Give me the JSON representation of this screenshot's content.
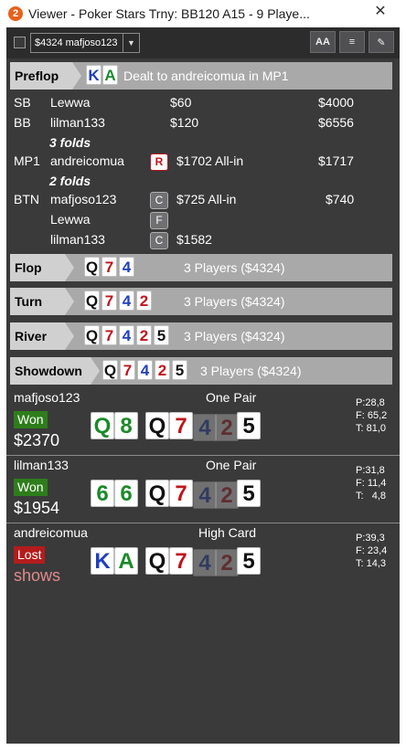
{
  "window": {
    "app_icon_glyph": "2",
    "title": "Viewer - Poker Stars Trny: BB120 A15 - 9 Playe..."
  },
  "toolbar": {
    "hand_select_value": "$4324 mafjoso123",
    "buttons": [
      "AA",
      "≡",
      "✎"
    ]
  },
  "preflop": {
    "label": "Preflop",
    "hero_cards": [
      {
        "rank": "K",
        "suit": "d"
      },
      {
        "rank": "A",
        "suit": "c"
      }
    ],
    "text": "Dealt to andreicomua in MP1",
    "rows": [
      {
        "pos": "SB",
        "name": "Lewwa",
        "action": "",
        "amount": "$60",
        "stack": "$4000"
      },
      {
        "pos": "BB",
        "name": "lilman133",
        "action": "",
        "amount": "$120",
        "stack": "$6556"
      },
      {
        "folds": "3 folds"
      },
      {
        "pos": "MP1",
        "name": "andreicomua",
        "action": "R",
        "amount": "$1702 All-in",
        "stack": "$1717"
      },
      {
        "folds": "2 folds"
      },
      {
        "pos": "BTN",
        "name": "mafjoso123",
        "action": "C",
        "amount": "$725 All-in",
        "stack": "$740"
      },
      {
        "pos": "",
        "name": "Lewwa",
        "action": "F",
        "amount": "",
        "stack": ""
      },
      {
        "pos": "",
        "name": "lilman133",
        "action": "C",
        "amount": "$1582",
        "stack": ""
      }
    ]
  },
  "streets": [
    {
      "label": "Flop",
      "cards": [
        {
          "rank": "Q",
          "suit": "s"
        },
        {
          "rank": "7",
          "suit": "h"
        },
        {
          "rank": "4",
          "suit": "d"
        }
      ],
      "text": "3 Players ($4324)"
    },
    {
      "label": "Turn",
      "cards": [
        {
          "rank": "Q",
          "suit": "s"
        },
        {
          "rank": "7",
          "suit": "h"
        },
        {
          "rank": "4",
          "suit": "d"
        },
        {
          "rank": "2",
          "suit": "h"
        }
      ],
      "text": "3 Players ($4324)"
    },
    {
      "label": "River",
      "cards": [
        {
          "rank": "Q",
          "suit": "s"
        },
        {
          "rank": "7",
          "suit": "h"
        },
        {
          "rank": "4",
          "suit": "d"
        },
        {
          "rank": "2",
          "suit": "h"
        },
        {
          "rank": "5",
          "suit": "s"
        }
      ],
      "text": "3 Players ($4324)"
    },
    {
      "label": "Showdown",
      "cards": [
        {
          "rank": "Q",
          "suit": "s"
        },
        {
          "rank": "7",
          "suit": "h"
        },
        {
          "rank": "4",
          "suit": "d"
        },
        {
          "rank": "2",
          "suit": "h"
        },
        {
          "rank": "5",
          "suit": "s"
        }
      ],
      "text": "3 Players ($4324)"
    }
  ],
  "showdown": [
    {
      "name": "mafjoso123",
      "hand": "One Pair",
      "result": "Won",
      "amount": "$2370",
      "hole": [
        {
          "rank": "Q",
          "suit": "c"
        },
        {
          "rank": "8",
          "suit": "c"
        }
      ],
      "board": [
        {
          "rank": "Q",
          "suit": "s",
          "used": true
        },
        {
          "rank": "7",
          "suit": "h",
          "used": true
        },
        {
          "rank": "4",
          "suit": "d",
          "used": false
        },
        {
          "rank": "2",
          "suit": "h",
          "used": false
        },
        {
          "rank": "5",
          "suit": "s",
          "used": true
        }
      ],
      "stats": [
        "P:28,8",
        "F: 65,2",
        "T: 81,0"
      ]
    },
    {
      "name": "lilman133",
      "hand": "One Pair",
      "result": "Won",
      "amount": "$1954",
      "hole": [
        {
          "rank": "6",
          "suit": "c"
        },
        {
          "rank": "6",
          "suit": "c"
        }
      ],
      "board": [
        {
          "rank": "Q",
          "suit": "s",
          "used": true
        },
        {
          "rank": "7",
          "suit": "h",
          "used": true
        },
        {
          "rank": "4",
          "suit": "d",
          "used": false
        },
        {
          "rank": "2",
          "suit": "h",
          "used": false
        },
        {
          "rank": "5",
          "suit": "s",
          "used": true
        }
      ],
      "stats": [
        "P:31,8",
        "F: 11,4",
        "T:   4,8"
      ]
    },
    {
      "name": "andreicomua",
      "hand": "High Card",
      "result": "Lost",
      "amount": "shows",
      "hole": [
        {
          "rank": "K",
          "suit": "d"
        },
        {
          "rank": "A",
          "suit": "c"
        }
      ],
      "board": [
        {
          "rank": "Q",
          "suit": "s",
          "used": true
        },
        {
          "rank": "7",
          "suit": "h",
          "used": true
        },
        {
          "rank": "4",
          "suit": "d",
          "used": false
        },
        {
          "rank": "2",
          "suit": "h",
          "used": false
        },
        {
          "rank": "5",
          "suit": "s",
          "used": true
        }
      ],
      "stats": [
        "P:39,3",
        "F: 23,4",
        "T: 14,3"
      ]
    }
  ],
  "colors": {
    "background": "#3a3a3b",
    "won": "#2e7d1b",
    "lost": "#b41c1c",
    "street_bar": "#a9a9a9",
    "street_tag": "#d0d0d0"
  }
}
